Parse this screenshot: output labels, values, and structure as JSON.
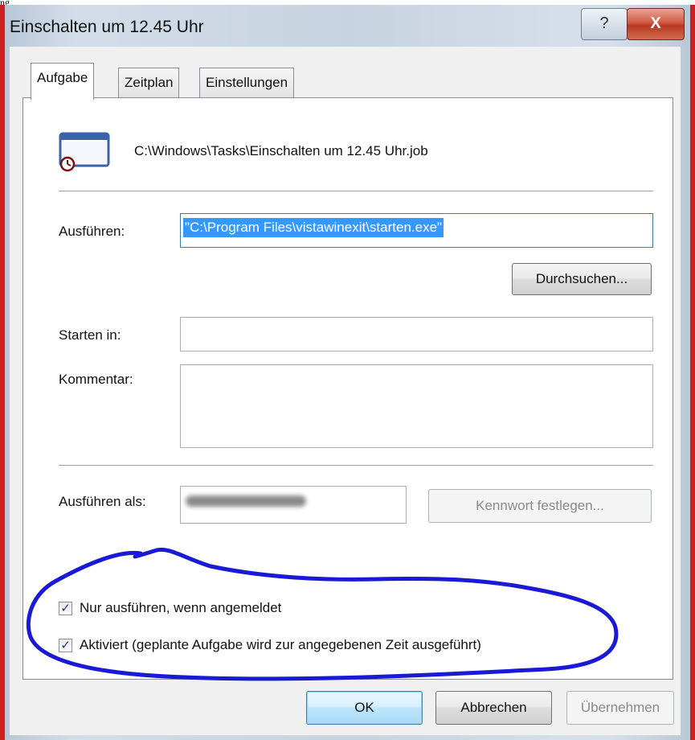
{
  "caption": "ng",
  "window": {
    "title": "Einschalten um 12.45 Uhr",
    "help_label": "?",
    "close_label": "X"
  },
  "tabs": [
    {
      "label": "Aufgabe"
    },
    {
      "label": "Zeitplan"
    },
    {
      "label": "Einstellungen"
    }
  ],
  "task": {
    "icon": "scheduled-task-icon",
    "path": "C:\\Windows\\Tasks\\Einschalten um 12.45 Uhr.job"
  },
  "run": {
    "label": "Ausführen:",
    "value": "\"C:\\Program Files\\vistawinexit\\starten.exe\"",
    "browse_label": "Durchsuchen..."
  },
  "start_in": {
    "label": "Starten in:",
    "value": ""
  },
  "comment": {
    "label": "Kommentar:",
    "value": ""
  },
  "run_as": {
    "label": "Ausführen als:",
    "set_password_label": "Kennwort festlegen..."
  },
  "checkboxes": [
    {
      "label": "Nur ausführen, wenn angemeldet",
      "checked": true
    },
    {
      "label": "Aktiviert (geplante Aufgabe wird zur angegebenen Zeit ausgeführt)",
      "checked": true
    }
  ],
  "footer": {
    "ok_label": "OK",
    "cancel_label": "Abbrechen",
    "apply_label": "Übernehmen"
  },
  "colors": {
    "annotation": "#1a1ad6",
    "frame": "#cc1f1f",
    "selection": "#3399ff"
  }
}
